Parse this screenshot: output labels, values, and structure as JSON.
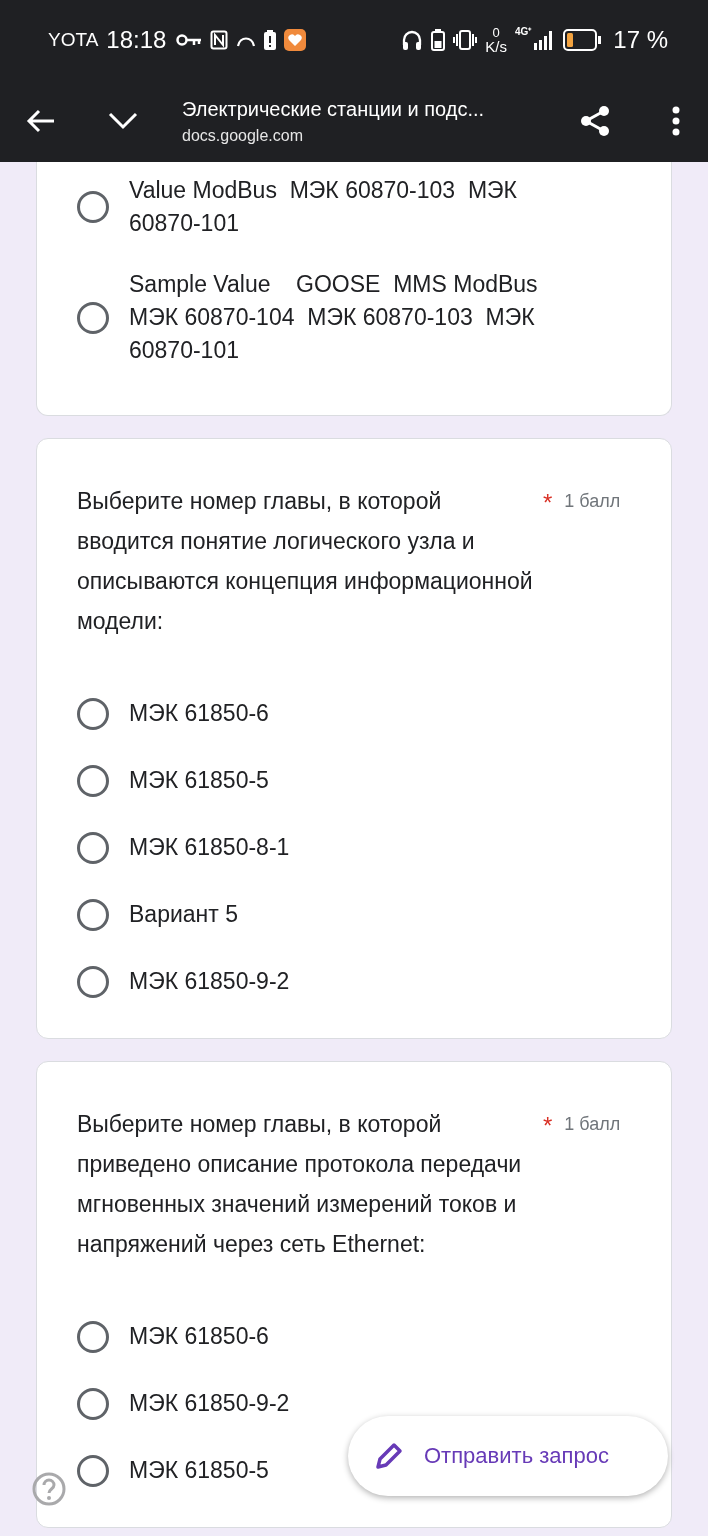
{
  "status_bar": {
    "carrier": "YOTA",
    "time": "18:18",
    "speed_value": "0",
    "speed_unit": "K/s",
    "network": "4G⁺",
    "battery": "17 %"
  },
  "app_bar": {
    "title": "Электрические станции и подс...",
    "url": "docs.google.com"
  },
  "questions": [
    {
      "partial": true,
      "options": [
        {
          "label": "Value ModBus  МЭК 60870-103  МЭК 60870-101",
          "selected": false
        },
        {
          "label": "Sample Value    GOOSE  MMS ModBus  МЭК 60870-104  МЭК 60870-103  МЭК 60870-101",
          "selected": false
        }
      ]
    },
    {
      "partial": false,
      "text": "Выберите номер главы, в которой вводится понятие логического узла и описываются концепция информационной модели:",
      "required_mark": "*",
      "points": "1 балл",
      "options": [
        {
          "label": "МЭК 61850-6",
          "selected": false
        },
        {
          "label": "МЭК 61850-5",
          "selected": false
        },
        {
          "label": "МЭК 61850-8-1",
          "selected": false
        },
        {
          "label": "Вариант 5",
          "selected": false
        },
        {
          "label": "МЭК 61850-9-2",
          "selected": false
        }
      ]
    },
    {
      "partial": false,
      "text": "Выберите номер главы, в которой приведено описание протокола передачи мгновенных значений измерений токов и напряжений через сеть Ethernet:",
      "required_mark": "*",
      "points": "1 балл",
      "options": [
        {
          "label": "МЭК 61850-6",
          "selected": false
        },
        {
          "label": "МЭК 61850-9-2",
          "selected": false
        },
        {
          "label": "МЭК 61850-5",
          "selected": false
        }
      ]
    }
  ],
  "fab": {
    "label": "Отправить запрос"
  }
}
